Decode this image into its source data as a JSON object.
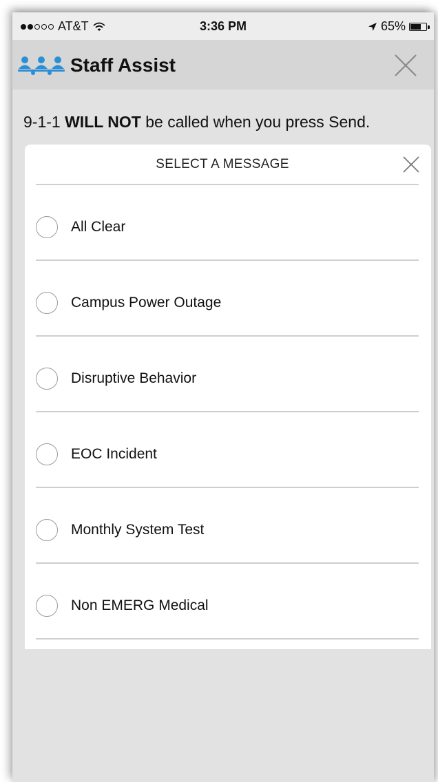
{
  "status_bar": {
    "carrier": "AT&T",
    "time": "3:36 PM",
    "battery": "65%",
    "battery_level": 0.65,
    "signal_bars_filled": 2,
    "signal_bars_total": 5,
    "icons": [
      "signal-dots-icon",
      "wifi-icon",
      "location-arrow-icon",
      "battery-icon"
    ]
  },
  "header": {
    "title": "Staff Assist",
    "logo_icon": "staff-group-icon",
    "close_icon": "close-icon",
    "logo_color": "#2b8fd6",
    "background": "#d6d6d6"
  },
  "warning": {
    "prefix": "9-1-1 ",
    "emphasis": "WILL NOT",
    "suffix": " be called when you press Send."
  },
  "modal": {
    "title": "SELECT A MESSAGE",
    "close_icon": "close-icon",
    "options": [
      {
        "label": "All Clear"
      },
      {
        "label": "Campus Power Outage"
      },
      {
        "label": "Disruptive Behavior"
      },
      {
        "label": "EOC Incident"
      },
      {
        "label": "Monthly System Test"
      },
      {
        "label": "Non EMERG Medical"
      }
    ]
  }
}
